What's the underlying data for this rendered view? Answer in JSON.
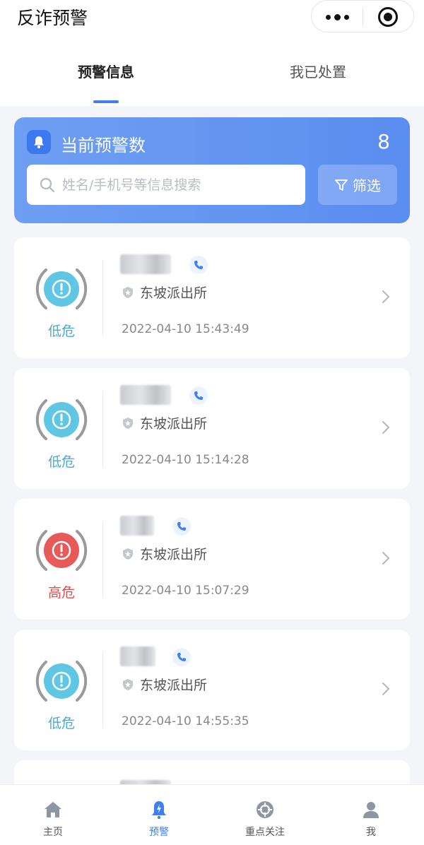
{
  "app": {
    "title": "反诈预警"
  },
  "tabs": {
    "warning": "预警信息",
    "handled": "我已处置"
  },
  "summary": {
    "label": "当前预警数",
    "count": "8"
  },
  "search": {
    "placeholder": "姓名/手机号等信息搜索",
    "filter_label": "筛选"
  },
  "cards": [
    {
      "risk": "低危",
      "risk_level": "low",
      "station": "东坡派出所",
      "time": "2022-04-10 15:43:49"
    },
    {
      "risk": "低危",
      "risk_level": "low",
      "station": "东坡派出所",
      "time": "2022-04-10 15:14:28"
    },
    {
      "risk": "高危",
      "risk_level": "high",
      "station": "东坡派出所",
      "time": "2022-04-10 15:07:29"
    },
    {
      "risk": "低危",
      "risk_level": "low",
      "station": "东坡派出所",
      "time": "2022-04-10 14:55:35"
    }
  ],
  "bottom_nav": [
    {
      "label": "主页",
      "icon": "home-icon"
    },
    {
      "label": "预警",
      "icon": "alert-bell-icon"
    },
    {
      "label": "重点关注",
      "icon": "target-icon"
    },
    {
      "label": "我",
      "icon": "user-icon"
    }
  ],
  "colors": {
    "accent": "#3f7ff0",
    "low_risk": "#4aa9cf",
    "high_risk": "#d94c4c",
    "banner": "#5a8df0"
  }
}
